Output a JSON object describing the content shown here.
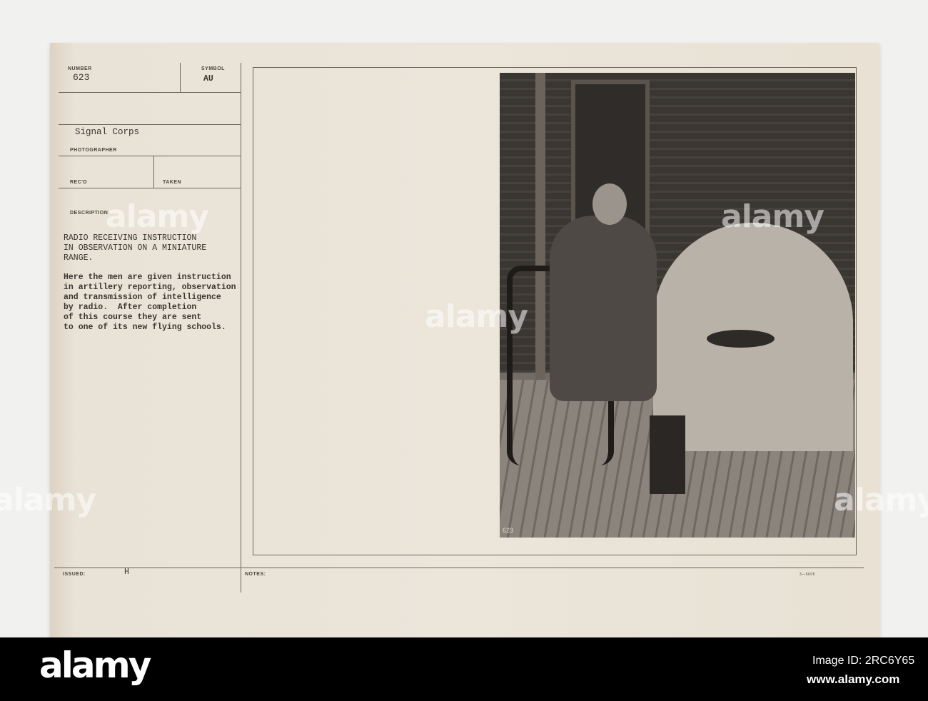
{
  "card": {
    "number_label": "NUMBER",
    "number": "623",
    "symbol_label": "SYMBOL",
    "symbol": "AU",
    "photographer": "Signal Corps",
    "photographer_label": "PHOTOGRAPHER",
    "recd_label": "REC'D",
    "taken_label": "TAKEN",
    "description_label": "DESCRIPTION:",
    "title_lines": [
      "RADIO RECEIVING INSTRUCTION",
      "IN OBSERVATION ON A MINIATURE",
      "RANGE."
    ],
    "body_lines": [
      "Here the men are given instruction",
      "in artillery reporting, observation",
      "and transmission of intelligence",
      "by radio.  After completion",
      "of this course they are sent",
      "to one of its new flying schools."
    ],
    "issued_label": "ISSUED:",
    "issued": "H",
    "notes_label": "NOTES:",
    "form_code": "3—5605",
    "photo_number": "623"
  },
  "watermark": "alamy",
  "banner": {
    "logo": "alamy",
    "image_id": "Image ID: 2RC6Y65",
    "url": "www.alamy.com"
  }
}
